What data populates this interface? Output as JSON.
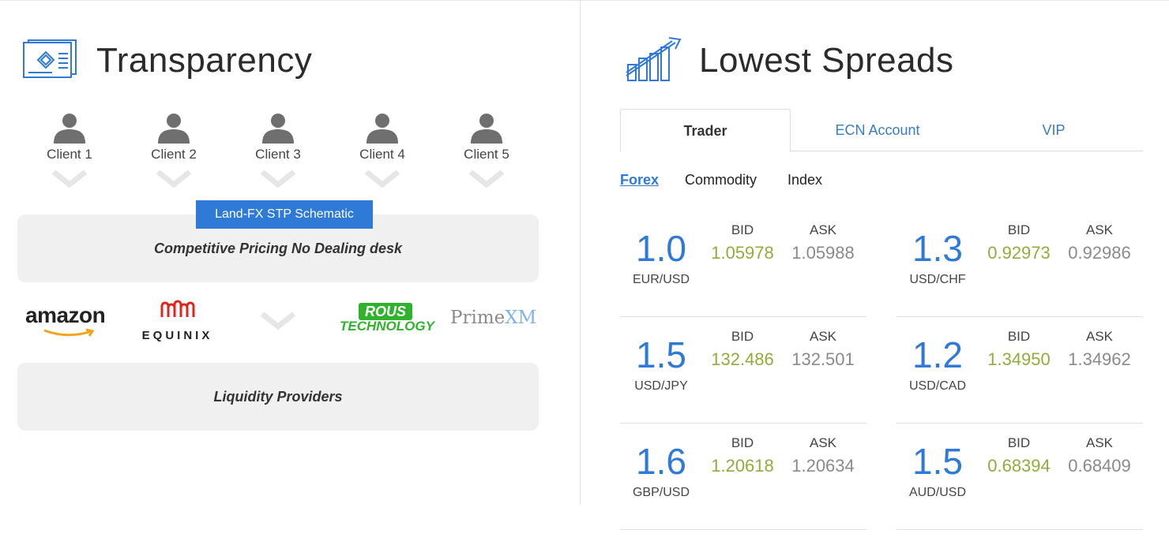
{
  "transparency": {
    "title": "Transparency",
    "clients": [
      "Client 1",
      "Client 2",
      "Client 3",
      "Client 4",
      "Client 5"
    ],
    "stp_badge": "Land-FX STP Schematic",
    "pricing_box": "Competitive Pricing No Dealing desk",
    "providers": {
      "amazon": "amazon",
      "equinix": "EQUINIX",
      "rous_top": "ROUS",
      "rous_bottom": "TECHNOLOGY",
      "prime": "Prime",
      "xm": "XM"
    },
    "liquidity_box": "Liquidity Providers"
  },
  "spreads": {
    "title": "Lowest Spreads",
    "tabs": [
      "Trader",
      "ECN Account",
      "VIP"
    ],
    "active_tab": "Trader",
    "subtabs": [
      "Forex",
      "Commodity",
      "Index"
    ],
    "active_subtab": "Forex",
    "bid_label": "BID",
    "ask_label": "ASK",
    "quotes": [
      {
        "spread": "1.0",
        "pair": "EUR/USD",
        "bid": "1.05978",
        "ask": "1.05988"
      },
      {
        "spread": "1.3",
        "pair": "USD/CHF",
        "bid": "0.92973",
        "ask": "0.92986"
      },
      {
        "spread": "1.5",
        "pair": "USD/JPY",
        "bid": "132.486",
        "ask": "132.501"
      },
      {
        "spread": "1.2",
        "pair": "USD/CAD",
        "bid": "1.34950",
        "ask": "1.34962"
      },
      {
        "spread": "1.6",
        "pair": "GBP/USD",
        "bid": "1.20618",
        "ask": "1.20634"
      },
      {
        "spread": "1.5",
        "pair": "AUD/USD",
        "bid": "0.68394",
        "ask": "0.68409"
      }
    ]
  },
  "colors": {
    "accent_blue": "#2f7ad6",
    "bid_green": "#8fad3b",
    "ask_gray": "#8a8a8a",
    "box_gray": "#f0f0f0"
  },
  "icons": [
    "document-icon",
    "growth-chart-icon",
    "person-icon",
    "chevron-down-icon"
  ]
}
